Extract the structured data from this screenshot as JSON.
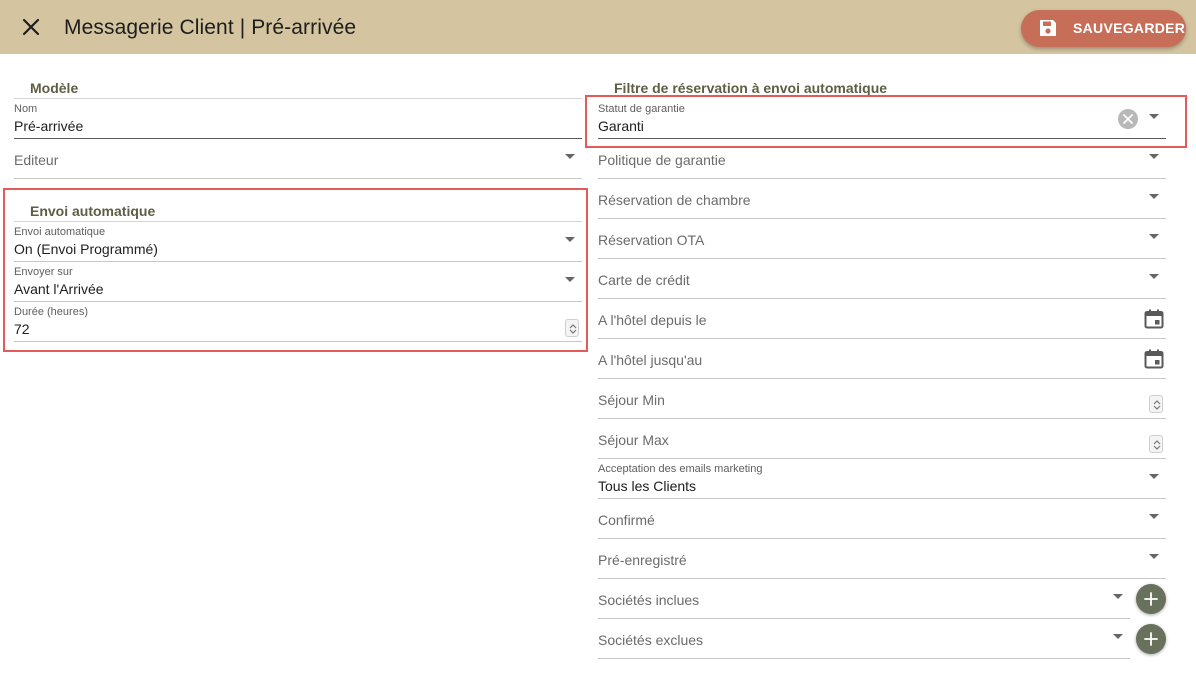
{
  "header": {
    "title": "Messagerie Client | Pré-arrivée",
    "save_label": "SAUVEGARDER"
  },
  "modele": {
    "section_title": "Modèle",
    "nom_label": "Nom",
    "nom_value": "Pré-arrivée",
    "editeur_placeholder": "Editeur"
  },
  "envoi": {
    "section_title": "Envoi automatique",
    "envoi_label": "Envoi automatique",
    "envoi_value": "On (Envoi Programmé)",
    "envoyer_label": "Envoyer sur",
    "envoyer_value": "Avant l'Arrivée",
    "duree_label": "Durée (heures)",
    "duree_value": "72"
  },
  "filtre": {
    "section_title": "Filtre de réservation à envoi automatique",
    "statut_label": "Statut de garantie",
    "statut_value": "Garanti",
    "politique": "Politique de garantie",
    "chambre": "Réservation de chambre",
    "ota": "Réservation OTA",
    "carte": "Carte de crédit",
    "depuis": "A l'hôtel depuis le",
    "jusqu": "A l'hôtel jusqu'au",
    "sejour_min": "Séjour Min",
    "sejour_max": "Séjour Max",
    "marketing_label": "Acceptation des emails marketing",
    "marketing_value": "Tous les Clients",
    "confirme": "Confirmé",
    "preenregistre": "Pré-enregistré",
    "societes_incluses": "Sociétés inclues",
    "societes_exclues": "Sociétés exclues"
  },
  "icons": {
    "close": "close-icon",
    "save": "floppy-disk-icon",
    "dropdown": "chevron-down-icon",
    "calendar": "calendar-icon",
    "stepper": "stepper-icon",
    "clear": "clear-icon",
    "add": "plus-icon"
  },
  "colors": {
    "header_bg": "#d4c4a0",
    "save_button": "#c76e58",
    "section_title": "#5e5e44",
    "add_button": "#68715b",
    "highlight_box": "#e45a5a"
  }
}
